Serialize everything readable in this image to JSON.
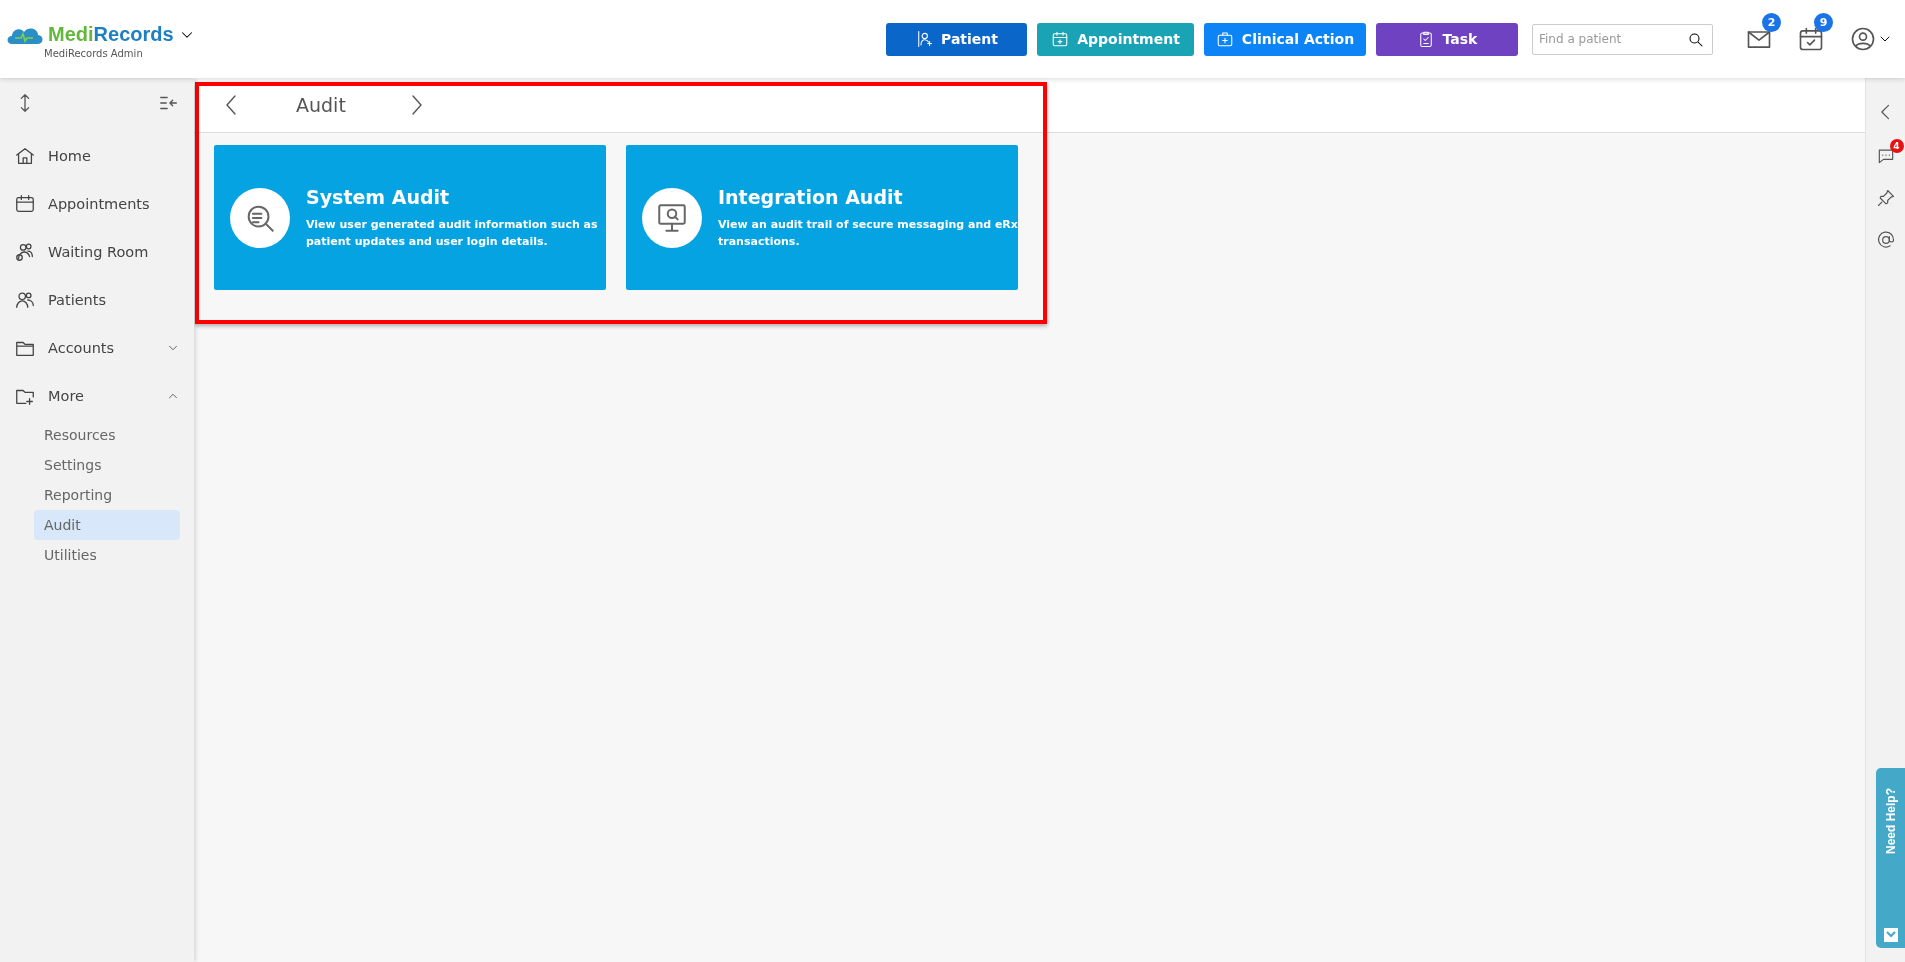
{
  "header": {
    "brand": [
      "Medi",
      "Records"
    ],
    "subtitle": "MediRecords Admin",
    "actions": [
      {
        "label": "Patient",
        "color": "#0a66c9"
      },
      {
        "label": "Appointment",
        "color": "#1aa3b5"
      },
      {
        "label": "Clinical Action",
        "color": "#0d84f5"
      },
      {
        "label": "Task",
        "color": "#6f42c1"
      }
    ],
    "search": {
      "placeholder": "Find a patient"
    },
    "messages_badge": "2",
    "calendar_badge": "9"
  },
  "sidebar": {
    "items": [
      {
        "label": "Home",
        "kind": "item",
        "selected": false
      },
      {
        "label": "Appointments",
        "kind": "item",
        "selected": false
      },
      {
        "label": "Waiting Room",
        "kind": "item",
        "selected": false
      },
      {
        "label": "Patients",
        "kind": "item",
        "selected": false
      },
      {
        "label": "Accounts",
        "kind": "group",
        "selected": false,
        "expanded": false
      },
      {
        "label": "More",
        "kind": "group",
        "selected": false,
        "expanded": true,
        "children": [
          {
            "label": "Resources",
            "selected": false
          },
          {
            "label": "Settings",
            "selected": false
          },
          {
            "label": "Reporting",
            "selected": false
          },
          {
            "label": "Audit",
            "selected": true
          },
          {
            "label": "Utilities",
            "selected": false
          }
        ]
      }
    ]
  },
  "page": {
    "title": "Audit",
    "cards": [
      {
        "title": "System Audit",
        "description": "View user generated audit information such as patient updates and user login details."
      },
      {
        "title": "Integration Audit",
        "description": "View an audit trail of secure messaging and eRx transactions."
      }
    ]
  },
  "right_rail": {
    "chat_badge": "4"
  },
  "help_tab": {
    "label": "Need Help?"
  }
}
